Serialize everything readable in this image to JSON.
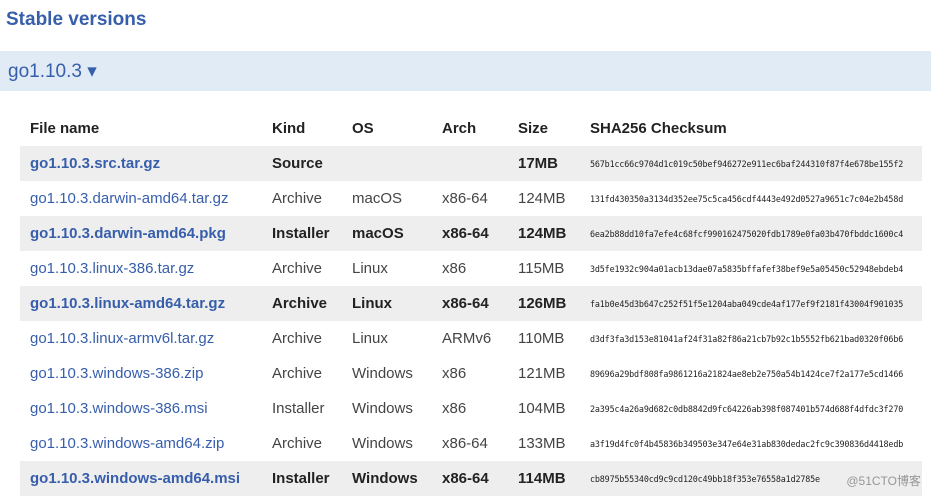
{
  "heading": "Stable versions",
  "version": {
    "label": "go1.10.3",
    "toggle_glyph": "▾"
  },
  "table": {
    "headers": [
      "File name",
      "Kind",
      "OS",
      "Arch",
      "Size",
      "SHA256 Checksum"
    ],
    "rows": [
      {
        "file": "go1.10.3.src.tar.gz",
        "kind": "Source",
        "os": "",
        "arch": "",
        "size": "17MB",
        "sha": "567b1cc66c9704d1c019c50bef946272e911ec6baf244310f87f4e678be155f2",
        "highlight": true
      },
      {
        "file": "go1.10.3.darwin-amd64.tar.gz",
        "kind": "Archive",
        "os": "macOS",
        "arch": "x86-64",
        "size": "124MB",
        "sha": "131fd430350a3134d352ee75c5ca456cdf4443e492d0527a9651c7c04e2b458d",
        "highlight": false
      },
      {
        "file": "go1.10.3.darwin-amd64.pkg",
        "kind": "Installer",
        "os": "macOS",
        "arch": "x86-64",
        "size": "124MB",
        "sha": "6ea2b88dd10fa7efe4c68fcf990162475020fdb1789e0fa03b470fbddc1600c4",
        "highlight": true
      },
      {
        "file": "go1.10.3.linux-386.tar.gz",
        "kind": "Archive",
        "os": "Linux",
        "arch": "x86",
        "size": "115MB",
        "sha": "3d5fe1932c904a01acb13dae07a5835bffafef38bef9e5a05450c52948ebdeb4",
        "highlight": false
      },
      {
        "file": "go1.10.3.linux-amd64.tar.gz",
        "kind": "Archive",
        "os": "Linux",
        "arch": "x86-64",
        "size": "126MB",
        "sha": "fa1b0e45d3b647c252f51f5e1204aba049cde4af177ef9f2181f43004f901035",
        "highlight": true
      },
      {
        "file": "go1.10.3.linux-armv6l.tar.gz",
        "kind": "Archive",
        "os": "Linux",
        "arch": "ARMv6",
        "size": "110MB",
        "sha": "d3df3fa3d153e81041af24f31a82f86a21cb7b92c1b5552fb621bad0320f06b6",
        "highlight": false
      },
      {
        "file": "go1.10.3.windows-386.zip",
        "kind": "Archive",
        "os": "Windows",
        "arch": "x86",
        "size": "121MB",
        "sha": "89696a29bdf808fa9861216a21824ae8eb2e750a54b1424ce7f2a177e5cd1466",
        "highlight": false
      },
      {
        "file": "go1.10.3.windows-386.msi",
        "kind": "Installer",
        "os": "Windows",
        "arch": "x86",
        "size": "104MB",
        "sha": "2a395c4a26a9d682c0db8842d9fc64226ab398f087401b574d688f4dfdc3f270",
        "highlight": false
      },
      {
        "file": "go1.10.3.windows-amd64.zip",
        "kind": "Archive",
        "os": "Windows",
        "arch": "x86-64",
        "size": "133MB",
        "sha": "a3f19d4fc0f4b45836b349503e347e64e31ab830dedac2fc9c390836d4418edb",
        "highlight": false
      },
      {
        "file": "go1.10.3.windows-amd64.msi",
        "kind": "Installer",
        "os": "Windows",
        "arch": "x86-64",
        "size": "114MB",
        "sha": "cb8975b55340cd9c9cd120c49bb18f353e76558a1d2785e",
        "highlight": true
      }
    ]
  },
  "watermark": "@51CTO博客"
}
